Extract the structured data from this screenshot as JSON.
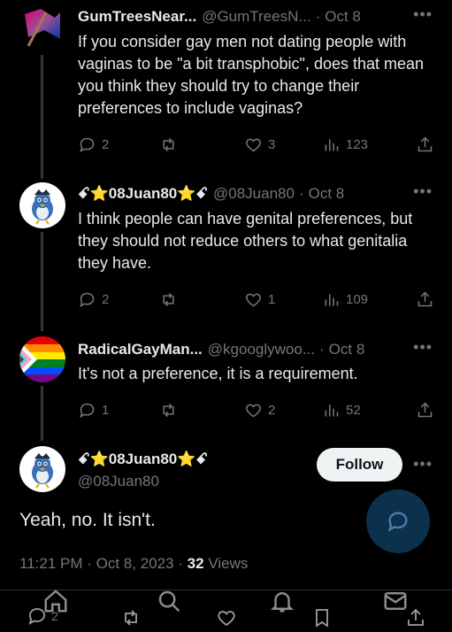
{
  "tweets": [
    {
      "name": "GumTreesNear...",
      "handle": "@GumTreesN...",
      "date": "Oct 8",
      "text": "If you consider gay men not dating people with vaginas to be \"a bit transphobic\", does that mean you think they should try to change their preferences to include vaginas?",
      "replies": "2",
      "retweets": "",
      "likes": "3",
      "views": "123"
    },
    {
      "name": "ꗃ⭐08Juan80⭐ꗃ",
      "handle": "@08Juan80",
      "date": "Oct 8",
      "text": "I think people can have genital preferences, but they should not reduce others to what genitalia they have.",
      "replies": "2",
      "retweets": "",
      "likes": "1",
      "views": "109"
    },
    {
      "name": "RadicalGayMan...",
      "handle": "@kgooglywoo...",
      "date": "Oct 8",
      "text": "It's not a preference, it is a requirement.",
      "replies": "1",
      "retweets": "",
      "likes": "2",
      "views": "52"
    }
  ],
  "main_tweet": {
    "name": "ꗃ⭐08Juan80⭐ꗃ",
    "handle": "@08Juan80",
    "follow_label": "Follow",
    "text": "Yeah, no. It isn't.",
    "time": "11:21 PM",
    "date": "Oct 8, 2023",
    "views_count": "32",
    "views_label": "Views",
    "replies": "2"
  },
  "icons": {
    "more": "more-icon",
    "reply": "reply-icon",
    "retweet": "retweet-icon",
    "like": "heart-icon",
    "views": "views-icon",
    "share": "share-icon",
    "compose": "compose-reply-icon"
  },
  "colors": {
    "background": "#000000",
    "text": "#e7e9ea",
    "muted": "#71767b",
    "follow_bg": "#eff3f4",
    "fab": "#0f3a5a"
  }
}
